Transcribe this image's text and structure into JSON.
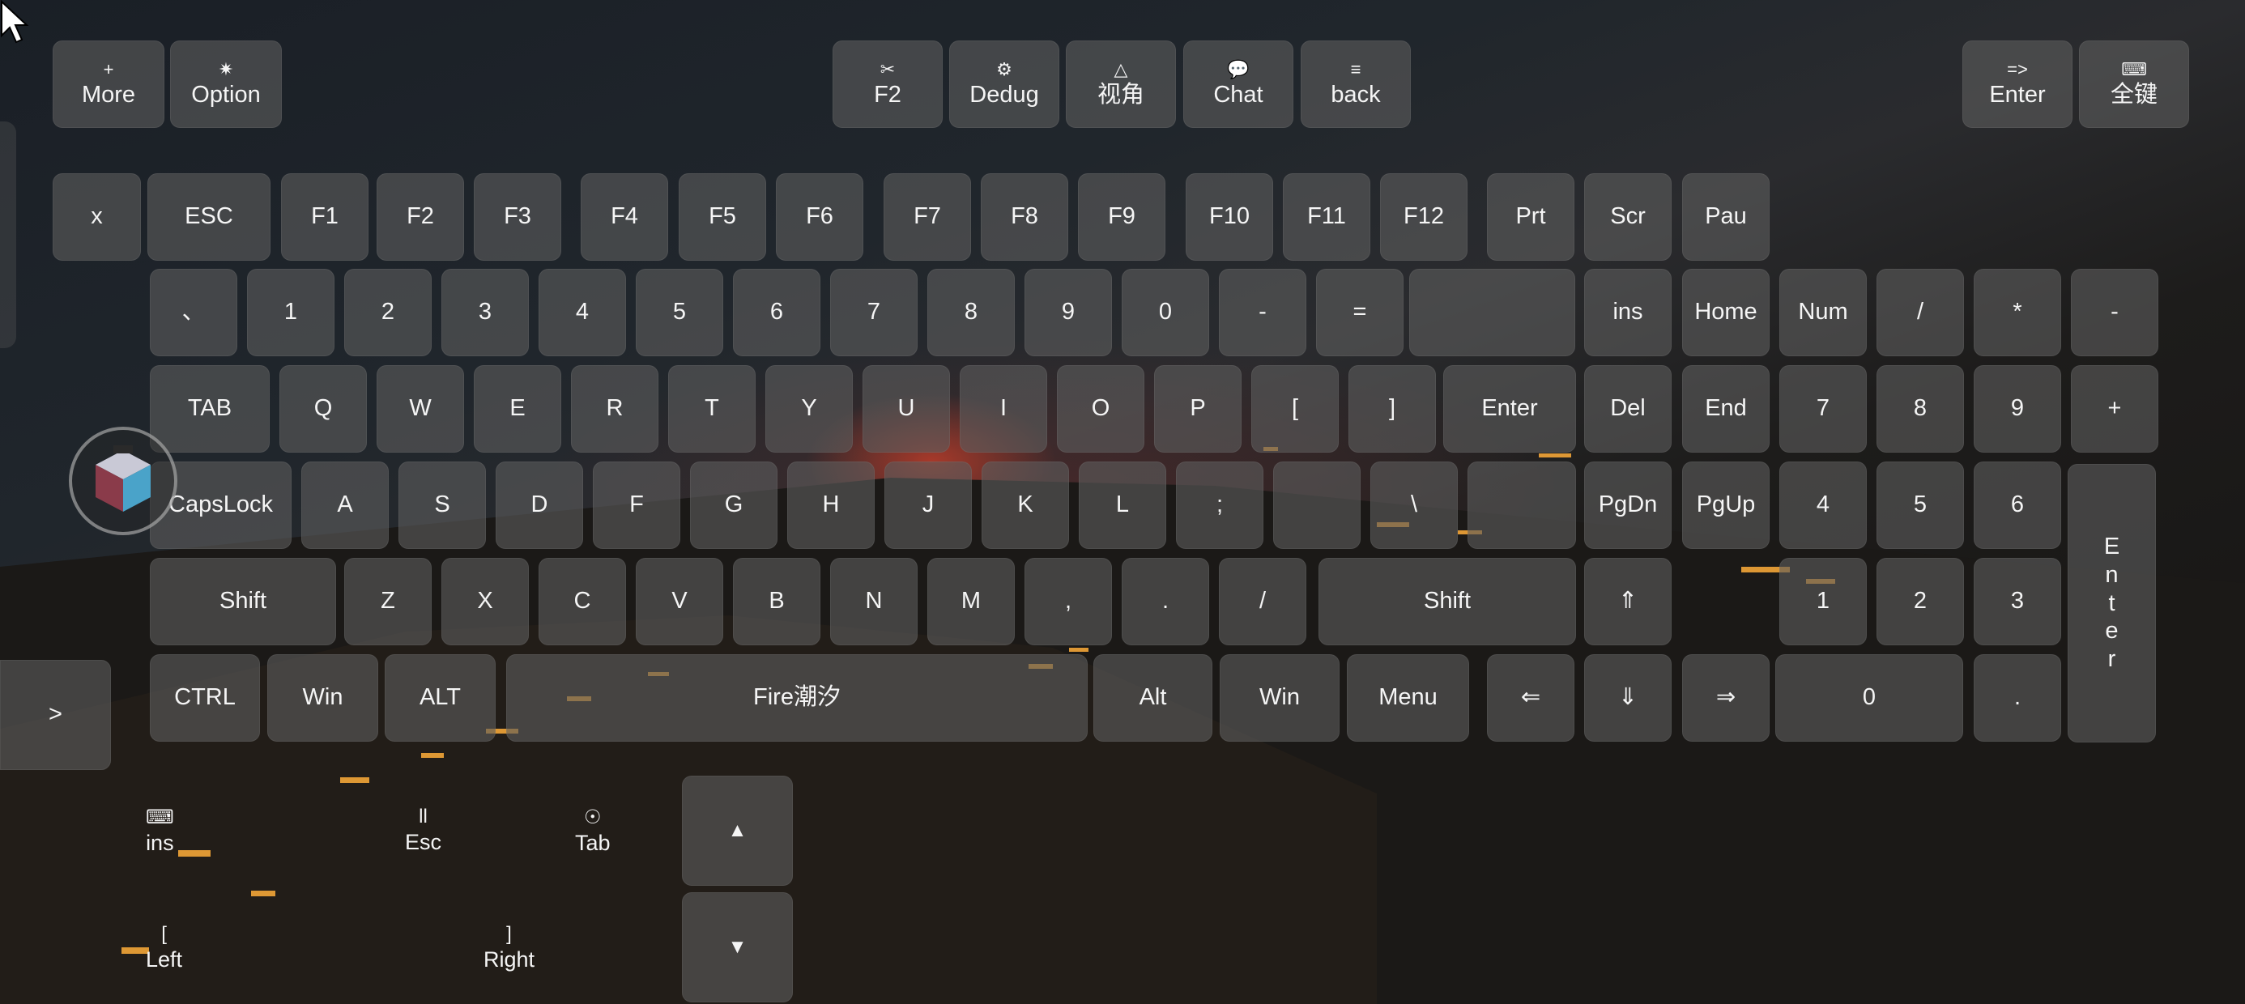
{
  "top_bar": {
    "more": {
      "icon": "+",
      "label": "More"
    },
    "option": {
      "icon": "✷",
      "label": "Option"
    },
    "f2": {
      "icon": "✂",
      "label": "F2"
    },
    "dedug": {
      "icon": "⚙",
      "label": "Dedug"
    },
    "view": {
      "icon": "△",
      "label": "视角"
    },
    "chat": {
      "icon": "💬",
      "label": "Chat"
    },
    "back": {
      "icon": "≡",
      "label": "back"
    },
    "enter": {
      "icon": "=>",
      "label": "Enter"
    },
    "all_keys": {
      "icon": "⌨",
      "label": "全键"
    }
  },
  "rows": {
    "fn": [
      "x",
      "ESC",
      "F1",
      "F2",
      "F3",
      "F4",
      "F5",
      "F6",
      "F7",
      "F8",
      "F9",
      "F10",
      "F11",
      "F12",
      "Prt",
      "Scr",
      "Pau"
    ],
    "num": [
      "、",
      "1",
      "2",
      "3",
      "4",
      "5",
      "6",
      "7",
      "8",
      "9",
      "0",
      "-",
      "=",
      ""
    ],
    "tab": [
      "TAB",
      "Q",
      "W",
      "E",
      "R",
      "T",
      "Y",
      "U",
      "I",
      "O",
      "P",
      "[",
      "]",
      "Enter"
    ],
    "caps": [
      "CapsLock",
      "A",
      "S",
      "D",
      "F",
      "G",
      "H",
      "J",
      "K",
      "L",
      ";",
      "",
      "\\",
      ""
    ],
    "shift": [
      "Shift",
      "Z",
      "X",
      "C",
      "V",
      "B",
      "N",
      "M",
      ",",
      ".",
      "/",
      "Shift"
    ],
    "bottom": [
      "CTRL",
      "Win",
      "ALT",
      "Fire潮汐",
      "Alt",
      "Win",
      "Menu"
    ]
  },
  "nav": {
    "row1": [
      "ins",
      "Home"
    ],
    "row2": [
      "Del",
      "End"
    ],
    "row3": [
      "PgDn",
      "PgUp"
    ],
    "up": "⇑",
    "arrows": [
      "⇐",
      "⇓",
      "⇒"
    ]
  },
  "numpad": {
    "row1": [
      "Num",
      "/",
      "*",
      "-"
    ],
    "row2": [
      "7",
      "8",
      "9",
      "+"
    ],
    "row3": [
      "4",
      "5",
      "6"
    ],
    "row4": [
      "1",
      "2",
      "3"
    ],
    "zero": "0",
    "dot": ".",
    "enter": "Enter"
  },
  "side_toggle": ">",
  "controls": {
    "ins": {
      "icon": "⌨",
      "label": "ins"
    },
    "esc": {
      "icon": "ll",
      "label": "Esc"
    },
    "tab": {
      "icon": "☉",
      "label": "Tab"
    },
    "left": {
      "icon": "[",
      "label": "Left"
    },
    "right": {
      "icon": "]",
      "label": "Right"
    },
    "up": "▲",
    "down": "▼"
  },
  "colors": {
    "key_bg": "#5c5c5c",
    "text": "#f5f5f5",
    "glow": "#ff4628"
  }
}
